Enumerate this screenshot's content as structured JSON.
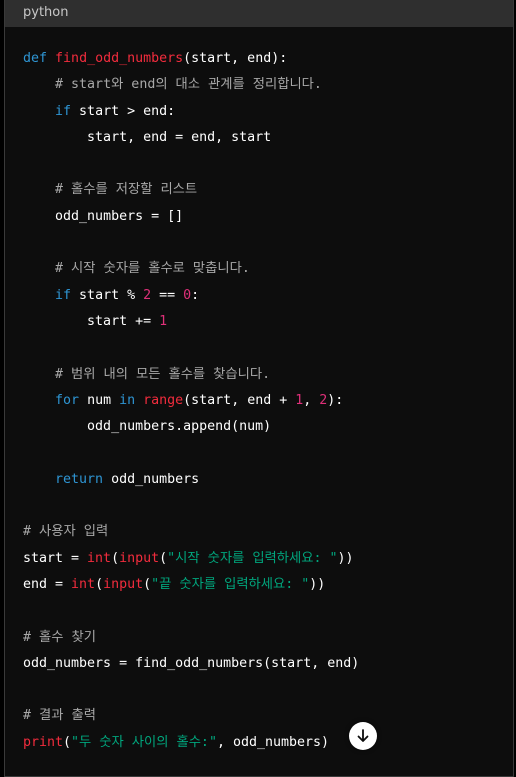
{
  "header": {
    "language": "python"
  },
  "code": {
    "l1": {
      "kw": "def",
      "fn": "find_odd_numbers",
      "rest": "(start, end):"
    },
    "l2": {
      "comment": "# start와 end의 대소 관계를 정리합니다."
    },
    "l3": {
      "kw": "if",
      "rest": " start > end:"
    },
    "l4": {
      "text": "start, end = end, start"
    },
    "l5": {
      "comment": "# 홀수를 저장할 리스트"
    },
    "l6": {
      "text": "odd_numbers = []"
    },
    "l7": {
      "comment": "# 시작 숫자를 홀수로 맞춥니다."
    },
    "l8": {
      "kw": "if",
      "a": " start % ",
      "n1": "2",
      "b": " == ",
      "n2": "0",
      "c": ":"
    },
    "l9": {
      "a": "start += ",
      "n1": "1"
    },
    "l10": {
      "comment": "# 범위 내의 모든 홀수를 찾습니다."
    },
    "l11": {
      "kw1": "for",
      "a": " num ",
      "kw2": "in",
      "fn": "range",
      "b": "(start, end + ",
      "n1": "1",
      "c": ", ",
      "n2": "2",
      "d": "):"
    },
    "l12": {
      "text": "odd_numbers.append(num)"
    },
    "l13": {
      "kw": "return",
      "rest": " odd_numbers"
    },
    "l14": {
      "comment": "# 사용자 입력"
    },
    "l15": {
      "a": "start = ",
      "fn1": "int",
      "b": "(",
      "fn2": "input",
      "c": "(",
      "str": "\"시작 숫자를 입력하세요: \"",
      "d": "))"
    },
    "l16": {
      "a": "end = ",
      "fn1": "int",
      "b": "(",
      "fn2": "input",
      "c": "(",
      "str": "\"끝 숫자를 입력하세요: \"",
      "d": "))"
    },
    "l17": {
      "comment": "# 홀수 찾기"
    },
    "l18": {
      "text": "odd_numbers = find_odd_numbers(start, end)"
    },
    "l19": {
      "comment": "# 결과 출력"
    },
    "l20": {
      "fn": "print",
      "a": "(",
      "str": "\"두 숫자 사이의 홀수:\"",
      "b": ", odd_numbers)"
    }
  },
  "scroll_button": {
    "icon": "arrow-down-icon"
  },
  "colors": {
    "keyword": "#2e95d3",
    "function": "#f22c3d",
    "number": "#df3079",
    "string": "#00a67d",
    "comment": "#a8a8a8",
    "text": "#ffffff",
    "background": "#0d0d0d",
    "header": "#2f2f2f"
  }
}
